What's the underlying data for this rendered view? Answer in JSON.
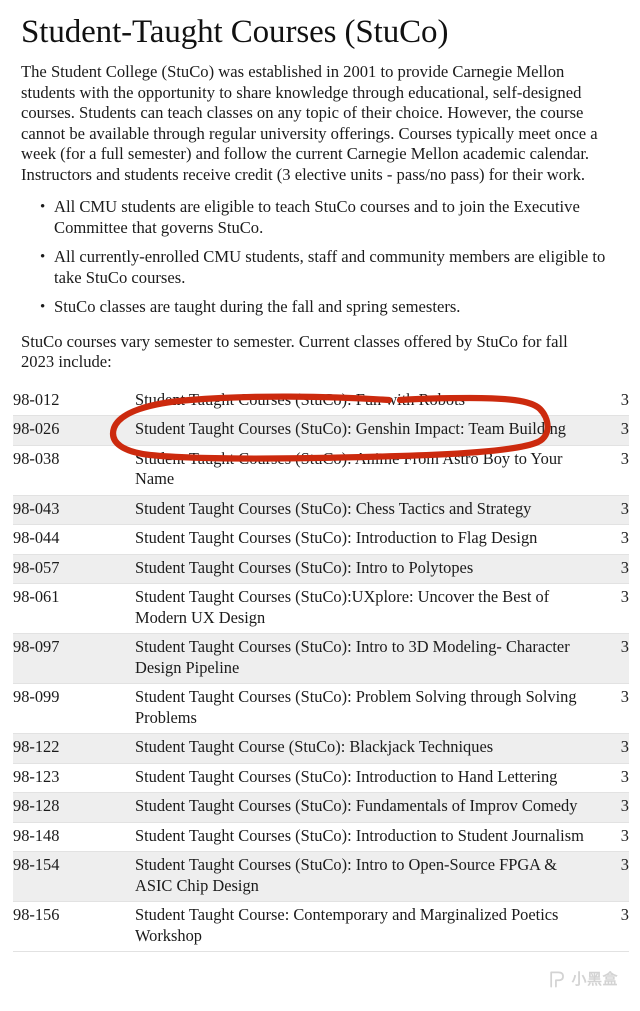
{
  "document": {
    "title": "Student-Taught Courses (StuCo)",
    "intro_paragraph": "The Student College (StuCo) was established in 2001 to provide Carnegie Mellon students with the opportunity to share knowledge through educational, self-designed courses. Students can teach classes on any topic of their choice. However, the course cannot be available through regular university offerings. Courses typically meet once a week (for a full semester) and follow the current Carnegie Mellon academic calendar. Instructors and students receive credit (3 elective units - pass/no pass) for their work.",
    "bullets": [
      "All CMU students are eligible to teach StuCo courses and to join the Executive Committee that governs StuCo.",
      "All currently-enrolled CMU students, staff and community members are eligible to take StuCo courses.",
      "StuCo classes are taught during the fall and spring semesters."
    ],
    "lead_in": "StuCo courses vary semester to semester. Current classes offered by StuCo for fall 2023 include:"
  },
  "course_table": {
    "rows": [
      {
        "number": "98-012",
        "title": "Student Taught Courses (StuCo): Fun with Robots",
        "units": "3"
      },
      {
        "number": "98-026",
        "title": "Student Taught Courses (StuCo): Genshin Impact: Team Building",
        "units": "3"
      },
      {
        "number": "98-038",
        "title": "Student Taught Courses (StuCo): Anime From Astro Boy to Your Name",
        "units": "3"
      },
      {
        "number": "98-043",
        "title": "Student Taught Courses (StuCo): Chess Tactics and Strategy",
        "units": "3"
      },
      {
        "number": "98-044",
        "title": "Student Taught Courses (StuCo): Introduction to Flag Design",
        "units": "3"
      },
      {
        "number": "98-057",
        "title": "Student Taught Courses (StuCo): Intro to Polytopes",
        "units": "3"
      },
      {
        "number": "98-061",
        "title": "Student Taught Courses (StuCo):UXplore: Uncover the Best of Modern UX Design",
        "units": "3"
      },
      {
        "number": "98-097",
        "title": "Student Taught Courses (StuCo): Intro to 3D Modeling- Character Design Pipeline",
        "units": "3"
      },
      {
        "number": "98-099",
        "title": "Student Taught Courses (StuCo): Problem Solving through Solving Problems",
        "units": "3"
      },
      {
        "number": "98-122",
        "title": "Student Taught Course (StuCo): Blackjack Techniques",
        "units": "3"
      },
      {
        "number": "98-123",
        "title": "Student Taught Courses (StuCo): Introduction to Hand Lettering",
        "units": "3"
      },
      {
        "number": "98-128",
        "title": "Student Taught Courses (StuCo): Fundamentals of Improv Comedy",
        "units": "3"
      },
      {
        "number": "98-148",
        "title": "Student Taught Courses (StuCo): Introduction to Student Journalism",
        "units": "3"
      },
      {
        "number": "98-154",
        "title": "Student Taught Courses (StuCo): Intro to Open-Source FPGA & ASIC Chip Design",
        "units": "3"
      },
      {
        "number": "98-156",
        "title": "Student Taught Course: Contemporary and Marginalized Poetics Workshop",
        "units": "3"
      }
    ]
  },
  "annotation": {
    "type": "hand-drawn-circle",
    "color": "#cc2a0e",
    "stroke_width": 6,
    "targets_row_number": "98-026",
    "targets_row_title": "Student Taught Courses (StuCo): Genshin Impact: Team Building"
  },
  "watermark": {
    "text": "小黑盒",
    "icon": "xiaoheihe-logo-icon",
    "color": "#3a3a3a"
  },
  "colors": {
    "page_background": "#ffffff",
    "row_stripe": "#eeeeee",
    "row_border": "#e2e2e2",
    "text": "#1b1b1b",
    "annotation_red": "#cc2a0e"
  }
}
